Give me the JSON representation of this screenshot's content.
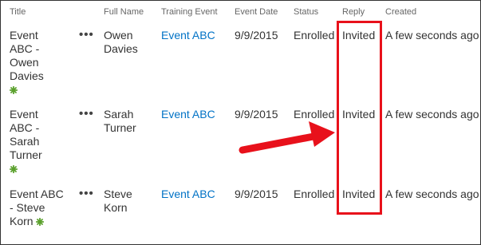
{
  "columns": {
    "title": "Title",
    "full_name": "Full Name",
    "training_event": "Training Event",
    "event_date": "Event Date",
    "status": "Status",
    "reply": "Reply",
    "created": "Created"
  },
  "rows": [
    {
      "title": "Event ABC - Owen Davies",
      "full_name": "Owen Davies",
      "training_event": "Event ABC",
      "event_date": "9/9/2015",
      "status": "Enrolled",
      "reply": "Invited",
      "created": "A few seconds ago"
    },
    {
      "title": "Event ABC - Sarah Turner",
      "full_name": "Sarah Turner",
      "training_event": "Event ABC",
      "event_date": "9/9/2015",
      "status": "Enrolled",
      "reply": "Invited",
      "created": "A few seconds ago"
    },
    {
      "title": "Event ABC - Steve Korn",
      "full_name": "Steve Korn",
      "training_event": "Event ABC",
      "event_date": "9/9/2015",
      "status": "Enrolled",
      "reply": "Invited",
      "created": "A few seconds ago"
    }
  ],
  "item_menu_glyph": "•••",
  "icons": {
    "new_item": "new-item-icon",
    "callout": "red-arrow"
  },
  "colors": {
    "link": "#0072c6",
    "highlight": "#e8111b",
    "new_icon": "#5aa02c"
  }
}
